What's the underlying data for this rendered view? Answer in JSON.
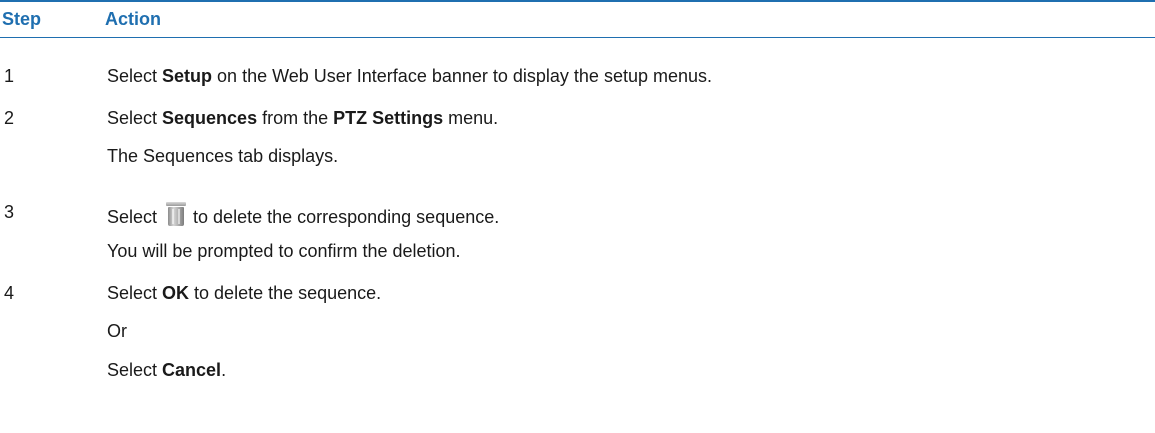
{
  "header": {
    "step_label": "Step",
    "action_label": "Action"
  },
  "steps": [
    {
      "number": "1",
      "lines": [
        {
          "pre": "Select ",
          "bold": "Setup",
          "post": " on the Web User Interface banner to display the setup menus."
        }
      ]
    },
    {
      "number": "2",
      "lines": [
        {
          "pre": "Select ",
          "bold": "Sequences",
          "mid": " from the ",
          "bold2": "PTZ Settings",
          "post": " menu."
        },
        {
          "text": "The Sequences tab displays."
        }
      ]
    },
    {
      "number": "3",
      "lines": [
        {
          "pre": "Select",
          "icon": "trash-icon",
          "post": "to delete the corresponding sequence."
        },
        {
          "text": "You will be prompted to confirm the deletion."
        }
      ]
    },
    {
      "number": "4",
      "lines": [
        {
          "pre": "Select ",
          "bold": "OK",
          "post": " to delete the sequence."
        },
        {
          "text": "Or"
        },
        {
          "pre": "Select ",
          "bold": "Cancel",
          "post": "."
        }
      ]
    }
  ],
  "colors": {
    "accent": "#1f6fb0",
    "text": "#1a1a1a"
  }
}
